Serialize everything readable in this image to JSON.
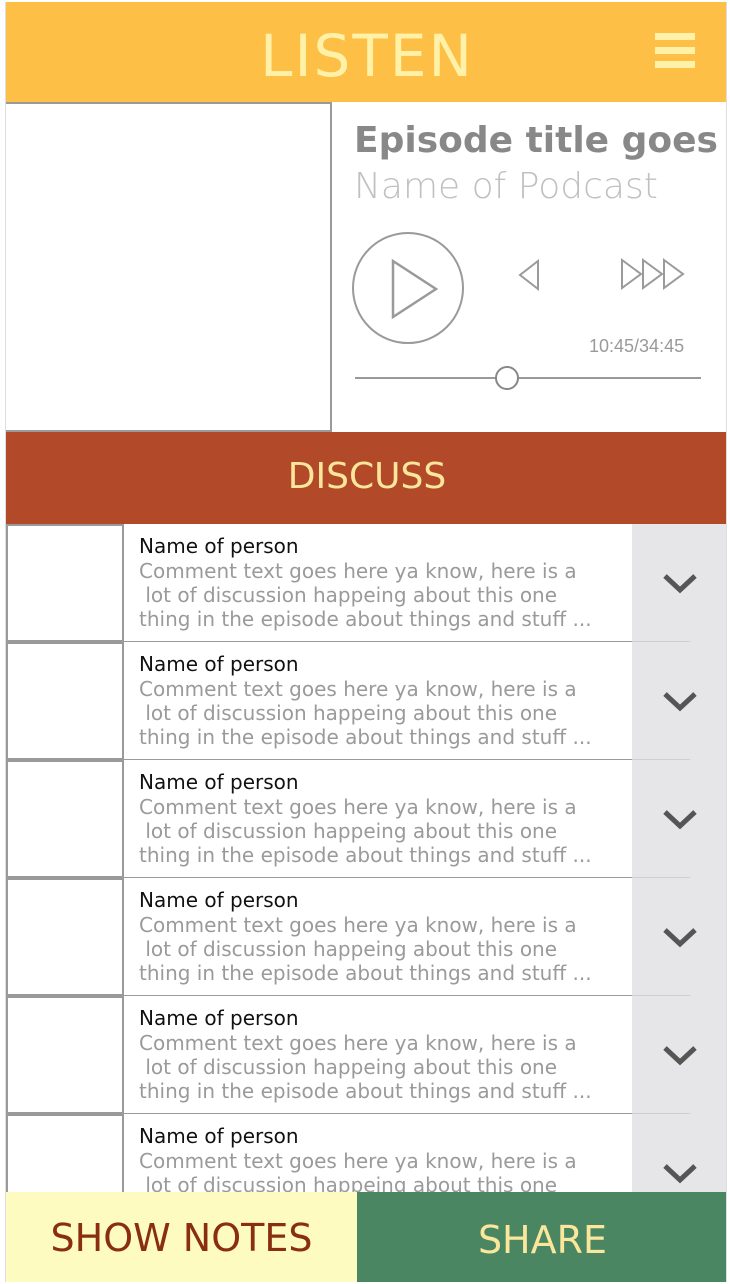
{
  "header": {
    "title": "LISTEN"
  },
  "player": {
    "episode_title": "Episode title goes here",
    "podcast_name": "Name of Podcast",
    "time": "10:45/34:45",
    "progress": 0.44
  },
  "discuss": {
    "title": "DISCUSS"
  },
  "comments": [
    {
      "name": "Name of person",
      "text": "Comment text goes here ya know, here is a\n lot of discussion happeing about this one\nthing in the episode about things and stuff ..."
    },
    {
      "name": "Name of person",
      "text": "Comment text goes here ya know, here is a\n lot of discussion happeing about this one\nthing in the episode about things and stuff ..."
    },
    {
      "name": "Name of person",
      "text": "Comment text goes here ya know, here is a\n lot of discussion happeing about this one\nthing in the episode about things and stuff ..."
    },
    {
      "name": "Name of person",
      "text": "Comment text goes here ya know, here is a\n lot of discussion happeing about this one\nthing in the episode about things and stuff ..."
    },
    {
      "name": "Name of person",
      "text": "Comment text goes here ya know, here is a\n lot of discussion happeing about this one\nthing in the episode about things and stuff ..."
    },
    {
      "name": "Name of person",
      "text": "Comment text goes here ya know, here is a\n lot of discussion happeing about this one\nthing in the episode about things and stuff ..."
    }
  ],
  "footer": {
    "show_notes_label": "SHOW NOTES",
    "share_label": "SHARE"
  },
  "icons": {
    "menu": "hamburger-menu-icon",
    "play": "play-icon",
    "rewind": "rewind-icon",
    "fast_forward": "fast-forward-icon",
    "expand": "chevron-down-icon"
  },
  "colors": {
    "listen": "#fdbf45",
    "discuss": "#b24a2a",
    "share": "#4b8662",
    "show_notes": "#fefbc0"
  }
}
